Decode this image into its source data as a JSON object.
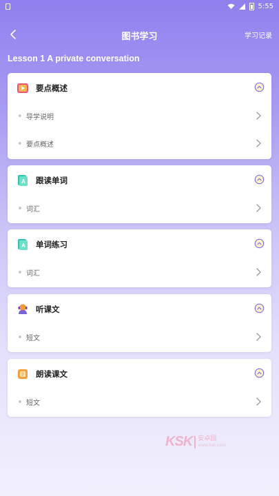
{
  "status_bar": {
    "time": "5:55"
  },
  "header": {
    "title": "图书学习",
    "history": "学习记录"
  },
  "lesson": {
    "title": "Lesson 1 A private conversation"
  },
  "sections": [
    {
      "title": "要点概述",
      "icon": "video-book-icon",
      "items": [
        {
          "label": "导学说明"
        },
        {
          "label": "要点概述"
        }
      ]
    },
    {
      "title": "跟读单词",
      "icon": "word-card-icon",
      "items": [
        {
          "label": "词汇"
        }
      ]
    },
    {
      "title": "单词练习",
      "icon": "word-practice-icon",
      "items": [
        {
          "label": "词汇"
        }
      ]
    },
    {
      "title": "听课文",
      "icon": "listening-icon",
      "items": [
        {
          "label": "短文"
        }
      ]
    },
    {
      "title": "朗读课文",
      "icon": "reading-aloud-icon",
      "items": [
        {
          "label": "短文"
        }
      ]
    }
  ],
  "watermark": {
    "logo": "KSK",
    "text": "安卓园",
    "sub": "www.ksk.com"
  },
  "colors": {
    "accent": "#7d6ae8",
    "header_bg": "#8f80ee"
  }
}
